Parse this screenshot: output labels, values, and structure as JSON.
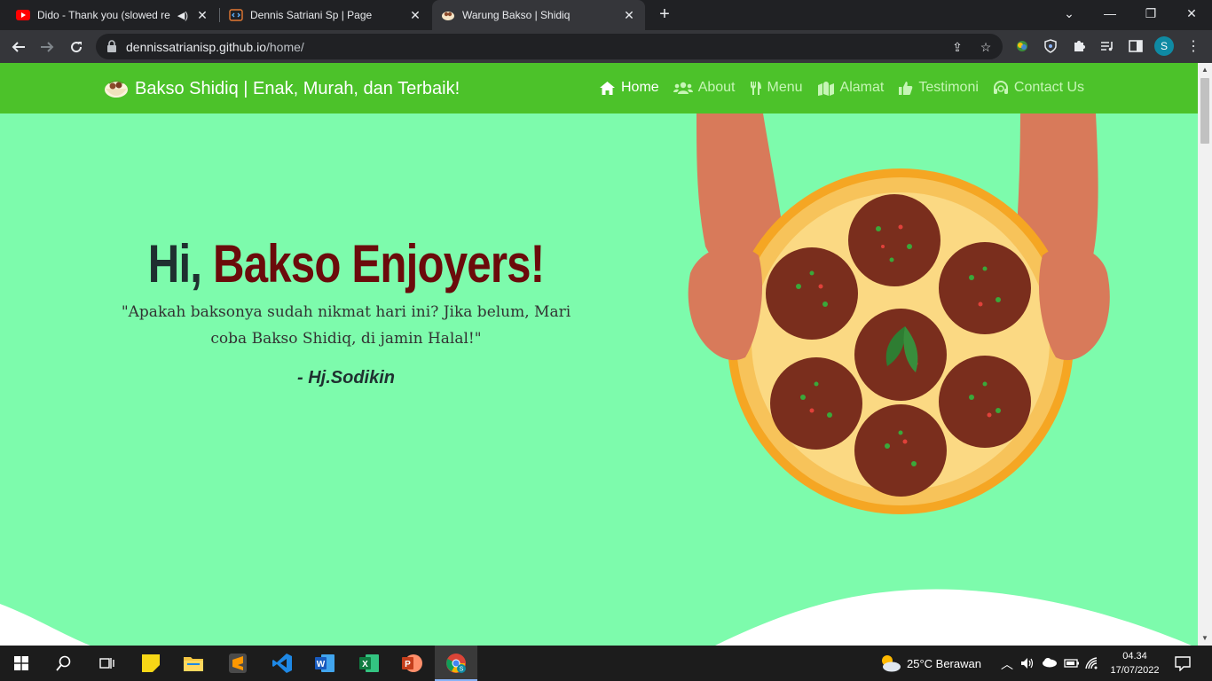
{
  "browser": {
    "tabs": [
      {
        "title": "Dido - Thank you (slowed re",
        "icon": "youtube-icon",
        "audio": true
      },
      {
        "title": "Dennis Satriani Sp | Page",
        "icon": "code-icon"
      },
      {
        "title": "Warung Bakso | Shidiq",
        "icon": "bakso-icon",
        "active": true
      }
    ],
    "url_host": "dennissatrianisp.github.io",
    "url_path": "/home/",
    "profile_initial": "S"
  },
  "site": {
    "brand": "Bakso Shidiq | Enak, Murah, dan Terbaik!",
    "nav": [
      {
        "label": "Home",
        "icon": "home-icon",
        "active": true
      },
      {
        "label": "About",
        "icon": "users-icon"
      },
      {
        "label": "Menu",
        "icon": "utensils-icon"
      },
      {
        "label": "Alamat",
        "icon": "map-icon"
      },
      {
        "label": "Testimoni",
        "icon": "thumbs-up-icon"
      },
      {
        "label": "Contact Us",
        "icon": "headset-icon"
      }
    ],
    "hero": {
      "greeting": "Hi,",
      "headline": "Bakso Enjoyers!",
      "quote_line1": "\"Apakah baksonya sudah nikmat hari ini? Jika belum, Mari",
      "quote_line2": "coba Bakso Shidiq, di jamin Halal!\"",
      "author": "- Hj.Sodikin"
    },
    "colors": {
      "navbar": "#4cc22a",
      "background": "#7dfbac",
      "accent": "#6b0b0b"
    }
  },
  "taskbar": {
    "weather": "25°C  Berawan",
    "time": "04.34",
    "date": "17/07/2022"
  }
}
